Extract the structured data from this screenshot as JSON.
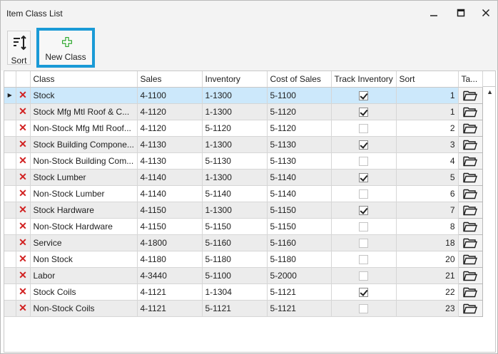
{
  "window": {
    "title": "Item Class List",
    "minimize_glyph": "—",
    "maximize_glyph": "□",
    "close_glyph": "✕"
  },
  "toolbar": {
    "sort_label": "Sort",
    "new_class_label": "New Class",
    "accent_color": "#1a9ad6",
    "plus_color": "#2aa52a"
  },
  "grid": {
    "columns": [
      "Class",
      "Sales",
      "Inventory",
      "Cost of Sales",
      "Track Inventory",
      "Sort",
      "Ta..."
    ],
    "rows": [
      {
        "class": "Stock",
        "sales": "4-1100",
        "inventory": "1-1300",
        "cost": "5-1100",
        "track": true,
        "sort": "1"
      },
      {
        "class": "Stock Mfg Mtl Roof & C...",
        "sales": "4-1120",
        "inventory": "1-1300",
        "cost": "5-1120",
        "track": true,
        "sort": "1"
      },
      {
        "class": "Non-Stock Mfg Mtl Roof...",
        "sales": "4-1120",
        "inventory": "5-1120",
        "cost": "5-1120",
        "track": false,
        "sort": "2"
      },
      {
        "class": "Stock Building Compone...",
        "sales": "4-1130",
        "inventory": "1-1300",
        "cost": "5-1130",
        "track": true,
        "sort": "3"
      },
      {
        "class": "Non-Stock Building Com...",
        "sales": "4-1130",
        "inventory": "5-1130",
        "cost": "5-1130",
        "track": false,
        "sort": "4"
      },
      {
        "class": "Stock Lumber",
        "sales": "4-1140",
        "inventory": "1-1300",
        "cost": "5-1140",
        "track": true,
        "sort": "5"
      },
      {
        "class": "Non-Stock Lumber",
        "sales": "4-1140",
        "inventory": "5-1140",
        "cost": "5-1140",
        "track": false,
        "sort": "6"
      },
      {
        "class": "Stock Hardware",
        "sales": "4-1150",
        "inventory": "1-1300",
        "cost": "5-1150",
        "track": true,
        "sort": "7"
      },
      {
        "class": "Non-Stock Hardware",
        "sales": "4-1150",
        "inventory": "5-1150",
        "cost": "5-1150",
        "track": false,
        "sort": "8"
      },
      {
        "class": "Service",
        "sales": "4-1800",
        "inventory": "5-1160",
        "cost": "5-1160",
        "track": false,
        "sort": "18"
      },
      {
        "class": "Non Stock",
        "sales": "4-1180",
        "inventory": "5-1180",
        "cost": "5-1180",
        "track": false,
        "sort": "20"
      },
      {
        "class": "Labor",
        "sales": "4-3440",
        "inventory": "5-1100",
        "cost": "5-2000",
        "track": false,
        "sort": "21"
      },
      {
        "class": "Stock Coils",
        "sales": "4-1121",
        "inventory": "1-1304",
        "cost": "5-1121",
        "track": true,
        "sort": "22"
      },
      {
        "class": "Non-Stock Coils",
        "sales": "4-1121",
        "inventory": "5-1121",
        "cost": "5-1121",
        "track": false,
        "sort": "23"
      }
    ],
    "row_indicator_glyph": "▶",
    "delete_glyph": "✕",
    "scroll_up_glyph": "▲"
  }
}
